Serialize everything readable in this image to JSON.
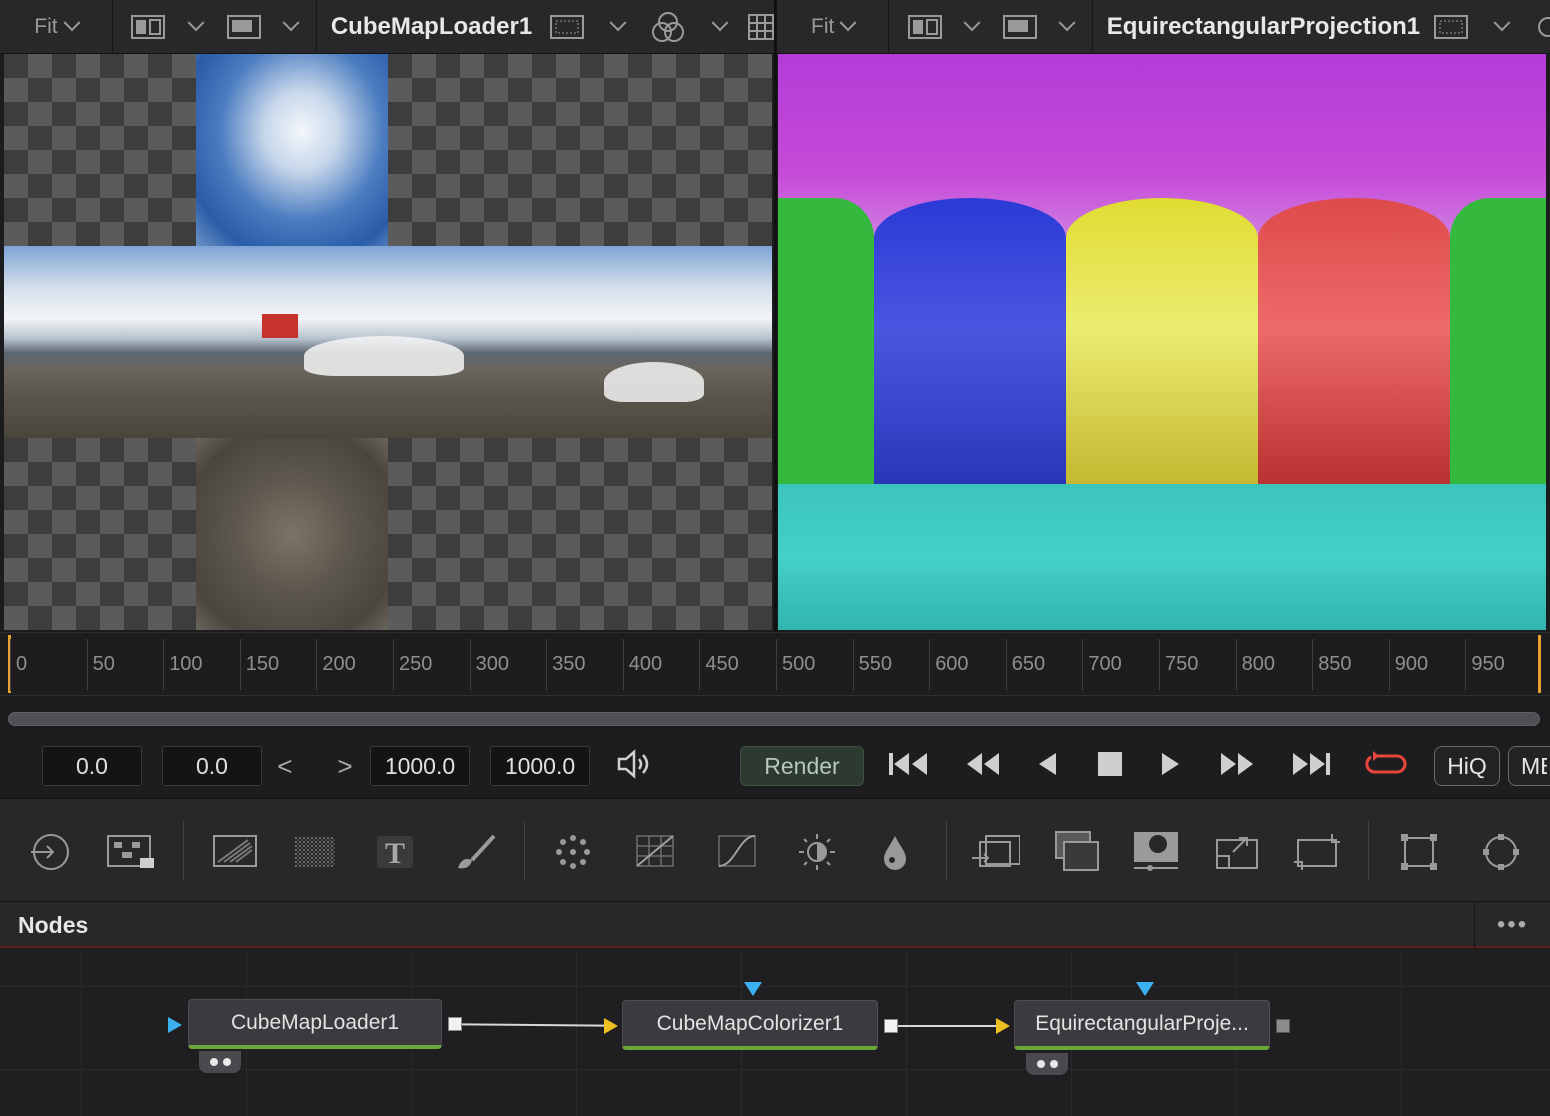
{
  "left_viewer": {
    "fit_label": "Fit",
    "title": "CubeMapLoader1"
  },
  "right_viewer": {
    "fit_label": "Fit",
    "title": "EquirectangularProjection1"
  },
  "timeline": {
    "ticks": [
      "0",
      "50",
      "100",
      "150",
      "200",
      "250",
      "300",
      "350",
      "400",
      "450",
      "500",
      "550",
      "600",
      "650",
      "700",
      "750",
      "800",
      "850",
      "900",
      "950"
    ]
  },
  "transport": {
    "render_start": "0.0",
    "global_start": "0.0",
    "render_end": "1000.0",
    "global_end": "1000.0",
    "prev_label": "<",
    "next_label": ">",
    "render_label": "Render",
    "hiq_label": "HiQ",
    "mb_label": "MB",
    "loop_color": "#e8453c"
  },
  "toolbar": {
    "icons": [
      "loader-icon",
      "merge-node-icon",
      "background-icon",
      "fast-noise-icon",
      "text-icon",
      "paint-icon",
      "particles-icon",
      "color-correct-icon",
      "curves-icon",
      "brightness-contrast-icon",
      "blur-icon",
      "transform-icon",
      "merge-icon",
      "matte-icon",
      "resize-icon",
      "crop-icon",
      "rectangle-mask-icon",
      "ellipse-mask-icon"
    ]
  },
  "nodes_panel": {
    "title": "Nodes",
    "menu_label": "•••",
    "nodes": [
      {
        "label": "CubeMapLoader1"
      },
      {
        "label": "CubeMapColorizer1"
      },
      {
        "label": "EquirectangularProje..."
      }
    ],
    "node_accent": "#6aa83a"
  },
  "colors": {
    "colorizer_top": "#c03ee0",
    "colorizer_green": "#2ec84a",
    "colorizer_blue": "#2a3cd8",
    "colorizer_yellow": "#e6e035",
    "colorizer_red": "#e64a4a",
    "colorizer_bottom": "#38d0c8",
    "playhead": "#e8a030"
  }
}
